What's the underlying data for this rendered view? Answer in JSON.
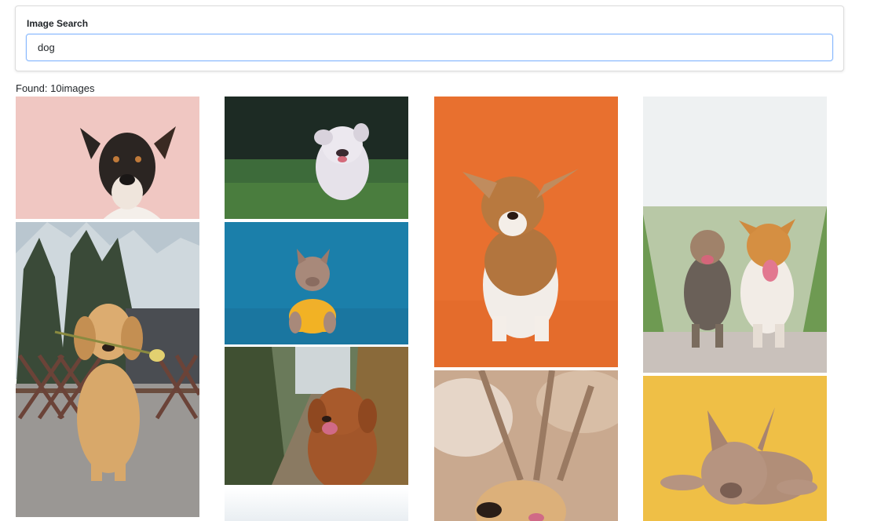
{
  "search": {
    "label": "Image Search",
    "value": "dog",
    "placeholder": ""
  },
  "results": {
    "found_prefix": "Found: ",
    "count": "10",
    "found_suffix": "images"
  },
  "colors": {
    "input_border": "#86b7fe",
    "card_border": "#dcdcdc"
  }
}
